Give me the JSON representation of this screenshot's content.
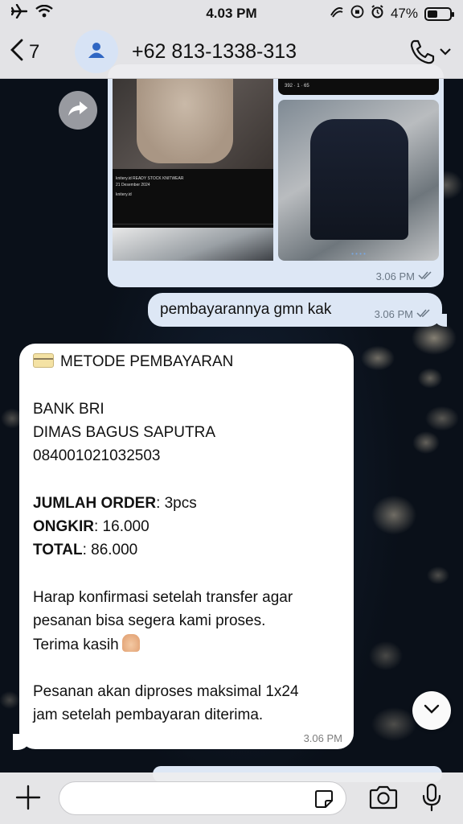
{
  "status_bar": {
    "time": "4.03 PM",
    "battery": "47%",
    "battery_level": 0.47
  },
  "header": {
    "back_count": "7",
    "contact_name": "+62 813-1338-313"
  },
  "image_message": {
    "left_shot_caption": "knitery.id READY STOCK KNITWEAR",
    "left_shot_date": "21 Desember 2024",
    "left_shot_account": "knitery.id",
    "right_shot_stats": "392 · 1 · 65",
    "time": "3.06 PM"
  },
  "outgoing_message": {
    "text": "pembayarannya gmn kak",
    "time": "3.06 PM"
  },
  "incoming_message": {
    "title": "METODE PEMBAYARAN",
    "bank": "BANK BRI",
    "account_name": "DIMAS BAGUS SAPUTRA",
    "account_number": "084001021032503",
    "order_label": "JUMLAH ORDER",
    "order_value": ": 3pcs",
    "shipping_label": "ONGKIR",
    "shipping_value": ": 16.000",
    "total_label": "TOTAL",
    "total_value": ": 86.000",
    "confirm_line1": "Harap konfirmasi setelah transfer agar",
    "confirm_line2": "pesanan bisa segera kami proses.",
    "confirm_line3": "Terima kasih",
    "process_line1": "Pesanan akan diproses maksimal 1x24",
    "process_line2": "jam setelah pembayaran diterima.",
    "time": "3.06 PM"
  },
  "icons": {
    "airplane": "airplane-icon",
    "wifi": "wifi-icon",
    "back": "chevron-left-icon",
    "avatar": "person-icon",
    "call": "phone-icon",
    "share": "share-icon",
    "scroll_down": "chevron-down-icon",
    "attach": "plus-icon",
    "sticker": "sticker-icon",
    "camera": "camera-icon",
    "mic": "microphone-icon"
  },
  "colors": {
    "accent": "#3b73c9",
    "outgoing_bubble": "#dde7f5",
    "incoming_bubble": "#ffffff"
  }
}
